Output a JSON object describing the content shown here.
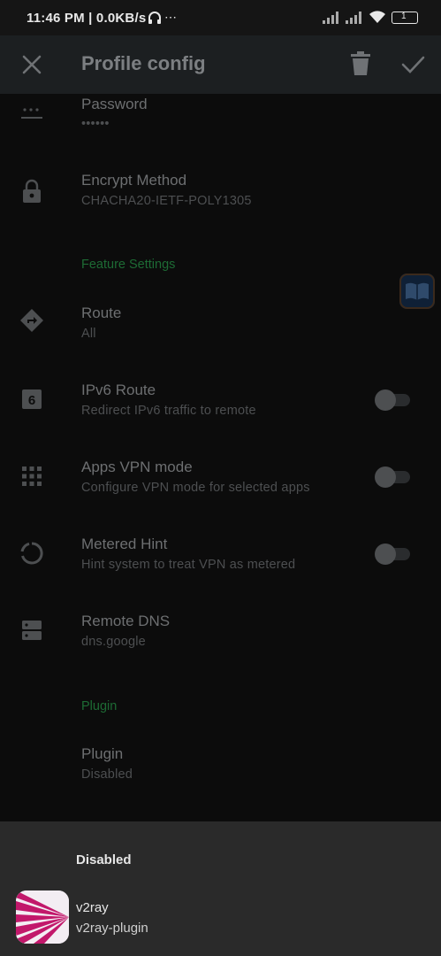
{
  "status_bar": {
    "time": "11:46 PM | 0.0KB/s",
    "battery": "1"
  },
  "app_bar": {
    "title": "Profile config"
  },
  "items": [
    {
      "title": "Password",
      "subtitle": "••••••",
      "icon": "password-icon"
    },
    {
      "title": "Encrypt Method",
      "subtitle": "CHACHA20-IETF-POLY1305",
      "icon": "lock-icon"
    },
    {
      "title": "Route",
      "subtitle": "All",
      "icon": "directions-icon"
    },
    {
      "title": "IPv6 Route",
      "subtitle": "Redirect IPv6 traffic to remote",
      "icon": "six-icon"
    },
    {
      "title": "Apps VPN mode",
      "subtitle": "Configure VPN mode for selected apps",
      "icon": "apps-grid-icon"
    },
    {
      "title": "Metered Hint",
      "subtitle": "Hint system to treat VPN as metered",
      "icon": "circle-progress-icon"
    },
    {
      "title": "Remote DNS",
      "subtitle": "dns.google",
      "icon": "dns-icon"
    },
    {
      "title": "Plugin",
      "subtitle": "Disabled"
    }
  ],
  "sections": {
    "feature_settings": "Feature Settings",
    "plugin": "Plugin"
  },
  "toggles": {
    "ipv6_route": false,
    "apps_vpn_mode": false,
    "metered_hint": false
  },
  "sheet": {
    "header": "Disabled",
    "option_name": "v2ray",
    "option_package": "v2ray-plugin"
  },
  "colors": {
    "accent": "#1d6b34",
    "sheet_bg": "#2a2a2a"
  }
}
